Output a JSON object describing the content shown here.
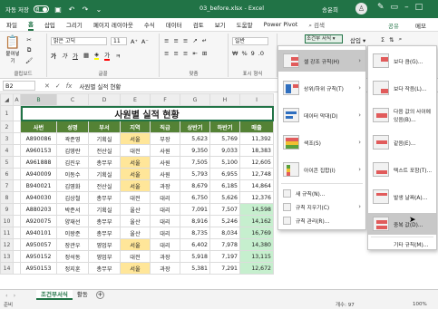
{
  "titlebar": {
    "autosave": "자동 저장",
    "toggle": "켬",
    "title": "03_before.xlsx - Excel",
    "user": "송윤희",
    "avatar_glyph": "♙"
  },
  "tabs": [
    "파일",
    "홈",
    "삽입",
    "그리기",
    "페이지 레이아웃",
    "수식",
    "데이터",
    "검토",
    "보기",
    "도움말",
    "Power Pivot",
    "검색"
  ],
  "active_tab": "홈",
  "share": "공유",
  "memo": "메모",
  "ribbon": {
    "clipboard_label": "클립보드",
    "paste_label": "붙여넣기",
    "font_label": "글꼴",
    "font_name": "맑은 고딕",
    "font_size": "11",
    "align_label": "맞춤",
    "number_label": "표시 형식",
    "number_format": "일반",
    "cf_button": "조건부 서식 ▾",
    "insert_button": "삽입 ▾"
  },
  "formula_bar": {
    "name_box": "B2",
    "value": "사원별 실적 현황"
  },
  "sheet": {
    "columns": [
      "A",
      "B",
      "C",
      "D",
      "E",
      "F",
      "G",
      "H",
      "I"
    ],
    "title": "사원별 실적 현황",
    "headers": [
      "사번",
      "성명",
      "부서",
      "지역",
      "직급",
      "상반기",
      "하반기",
      "매출"
    ],
    "rows": [
      {
        "rn": "3",
        "c": [
          "A890086",
          "곽준영",
          "기획실",
          "서울",
          "부장",
          "5,623",
          "5,769",
          "11,392"
        ]
      },
      {
        "rn": "4",
        "c": [
          "A960153",
          "김영란",
          "전산실",
          "대전",
          "사원",
          "9,350",
          "9,033",
          "18,383"
        ]
      },
      {
        "rn": "5",
        "c": [
          "A961888",
          "김진우",
          "총무부",
          "서울",
          "사원",
          "7,505",
          "5,100",
          "12,605"
        ]
      },
      {
        "rn": "6",
        "c": [
          "A940009",
          "이동수",
          "기획실",
          "서울",
          "사원",
          "5,793",
          "6,955",
          "12,748"
        ]
      },
      {
        "rn": "7",
        "c": [
          "B940021",
          "김영화",
          "전산실",
          "서울",
          "과장",
          "8,679",
          "6,185",
          "14,864"
        ]
      },
      {
        "rn": "8",
        "c": [
          "A940030",
          "김상철",
          "총무부",
          "대전",
          "대리",
          "6,750",
          "5,626",
          "12,376"
        ]
      },
      {
        "rn": "9",
        "c": [
          "A880203",
          "박준서",
          "기획실",
          "울산",
          "대리",
          "7,091",
          "7,507",
          "14,598"
        ]
      },
      {
        "rn": "10",
        "c": [
          "A920075",
          "양재선",
          "총무부",
          "울산",
          "대리",
          "8,916",
          "5,246",
          "14,162"
        ]
      },
      {
        "rn": "11",
        "c": [
          "A940101",
          "이왕준",
          "총무부",
          "울산",
          "대리",
          "8,735",
          "8,034",
          "16,769"
        ]
      },
      {
        "rn": "12",
        "c": [
          "A950057",
          "장관우",
          "영업부",
          "서울",
          "대리",
          "6,402",
          "7,978",
          "14,380"
        ]
      },
      {
        "rn": "13",
        "c": [
          "A950152",
          "정석동",
          "영업부",
          "대전",
          "과장",
          "5,918",
          "7,197",
          "13,115"
        ]
      },
      {
        "rn": "14",
        "c": [
          "A950153",
          "정지훈",
          "총무부",
          "서울",
          "과장",
          "5,381",
          "7,291",
          "12,672"
        ]
      }
    ]
  },
  "menu_main": [
    {
      "label": "셀 강조 규칙(H)",
      "arrow": "›"
    },
    {
      "label": "상위/하위 규칙(T)",
      "arrow": "›"
    },
    {
      "label": "데이터 막대(D)",
      "arrow": "›"
    },
    {
      "label": "색조(S)",
      "arrow": "›"
    },
    {
      "label": "아이콘 집합(I)",
      "arrow": "›"
    },
    {
      "label": "새 규칙(N)...",
      "arrow": ""
    },
    {
      "label": "규칙 지우기(C)",
      "arrow": "›"
    },
    {
      "label": "규칙 관리(R)...",
      "arrow": ""
    }
  ],
  "menu_sub": [
    {
      "label": "보다 큼(G)..."
    },
    {
      "label": "보다 작음(L)..."
    },
    {
      "label": "다음 값의 사이에 있음(B)..."
    },
    {
      "label": "같음(E)..."
    },
    {
      "label": "텍스트 포함(T)..."
    },
    {
      "label": "발생 날짜(A)..."
    },
    {
      "label": "중복 값(D)..."
    },
    {
      "label": "기타 규칙(M)..."
    }
  ],
  "sheet_tabs": [
    "조건부서식",
    "활동"
  ],
  "status": {
    "ready": "준비",
    "count": "개수: 97",
    "zoom": "100%"
  },
  "colors": {
    "excel_green": "#217346",
    "header_fill": "#548235",
    "seoul_fill": "#ffe699",
    "sales_fill": "#c6efce"
  }
}
